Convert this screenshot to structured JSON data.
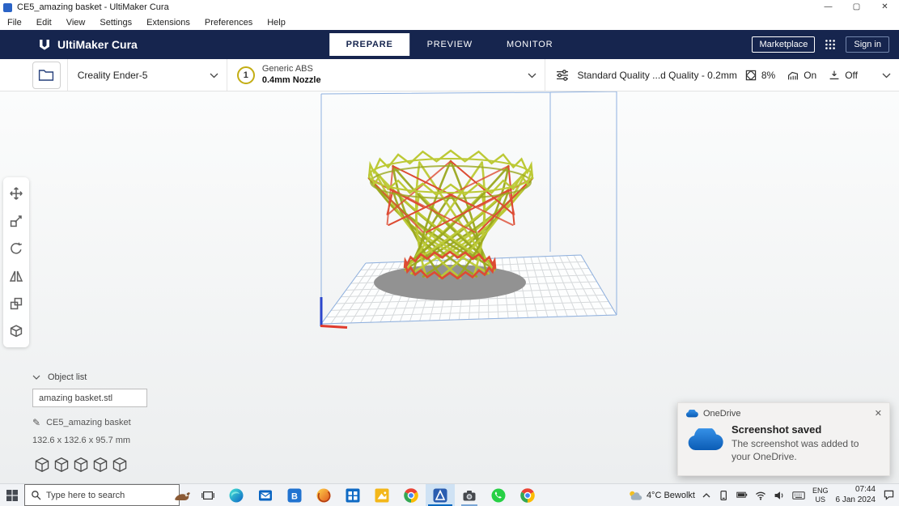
{
  "window": {
    "title": "CE5_amazing basket - UltiMaker Cura",
    "minimize": "—",
    "maximize": "▢",
    "close": "✕"
  },
  "menu": {
    "items": [
      "File",
      "Edit",
      "View",
      "Settings",
      "Extensions",
      "Preferences",
      "Help"
    ]
  },
  "header": {
    "app_name": "UltiMaker Cura",
    "tab_prepare": "PREPARE",
    "tab_preview": "PREVIEW",
    "tab_monitor": "MONITOR",
    "marketplace": "Marketplace",
    "sign_in": "Sign in"
  },
  "config": {
    "printer_name": "Creality Ender-5",
    "extruder_number": "1",
    "material_name": "Generic ABS",
    "nozzle": "0.4mm Nozzle",
    "profile": "Standard Quality ...d Quality - 0.2mm",
    "infill": "8%",
    "support_label": "On",
    "adhesion_label": "Off"
  },
  "object_list": {
    "title": "Object list",
    "file_name": "amazing basket.stl",
    "project_name": "CE5_amazing basket",
    "dimensions": "132.6 x 132.6 x 95.7 mm"
  },
  "toast": {
    "app": "OneDrive",
    "title": "Screenshot saved",
    "message": "The screenshot was added to your OneDrive.",
    "close": "✕"
  },
  "taskbar": {
    "search_placeholder": "Type here to search",
    "bing_letter": "B",
    "weather": "4°C  Bewolkt",
    "lang_line1": "ENG",
    "lang_line2": "US",
    "time": "07:44",
    "date": "6 Jan 2024"
  },
  "icons": {
    "pencil": "✎"
  },
  "colors": {
    "header_navy": "#16254e",
    "model_yellow": "#bcc935",
    "model_dark_yellow": "#9aa81f",
    "model_red": "#dd4b33",
    "grid_line": "#d6d9db",
    "build_line": "#8fb1e0",
    "shadow": "#929292",
    "onedrive_blue": "#0f6cbf",
    "accent_blue": "#0067c0"
  }
}
